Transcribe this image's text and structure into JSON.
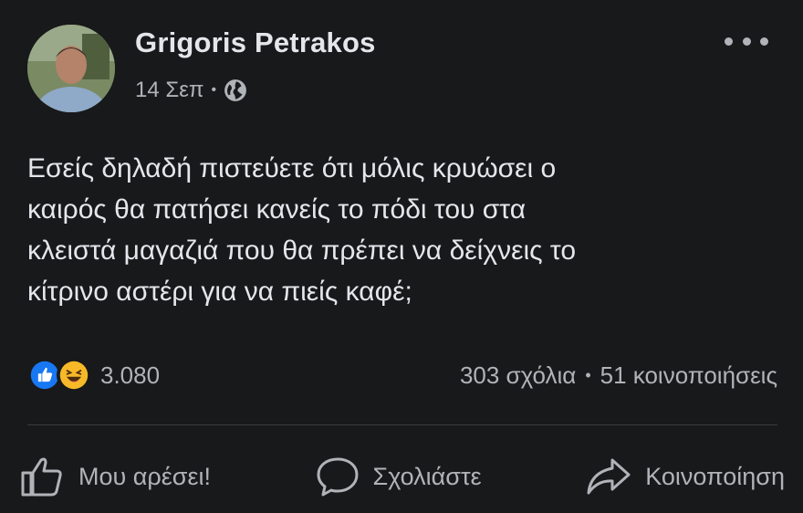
{
  "post": {
    "author": "Grigoris Petrakos",
    "date": "14 Σεπ",
    "meta_separator": "•",
    "privacy_icon": "globe-icon",
    "more_icon": "more-options-icon",
    "text": "Εσείς δηλαδή πιστεύετε ότι μόλις κρυώσει ο\nκαιρός θα πατήσει κανείς το πόδι του στα\nκλειστά μαγαζιά που θα πρέπει να δείχνεις το\nκίτρινο αστέρι για να πιείς καφέ;"
  },
  "stats": {
    "reactions": [
      "like-reaction-icon",
      "haha-reaction-icon"
    ],
    "reaction_count": "3.080",
    "comments": "303 σχόλια",
    "separator": "•",
    "shares": "51 κοινοποιήσεις"
  },
  "actions": {
    "like": "Μου αρέσει!",
    "comment": "Σχολιάστε",
    "share": "Κοινοποίηση"
  },
  "colors": {
    "background": "#18191a",
    "primary_text": "#e4e6eb",
    "secondary_text": "#b0b3b8",
    "like_blue": "#1877f2",
    "haha_yellow": "#f7b928"
  }
}
